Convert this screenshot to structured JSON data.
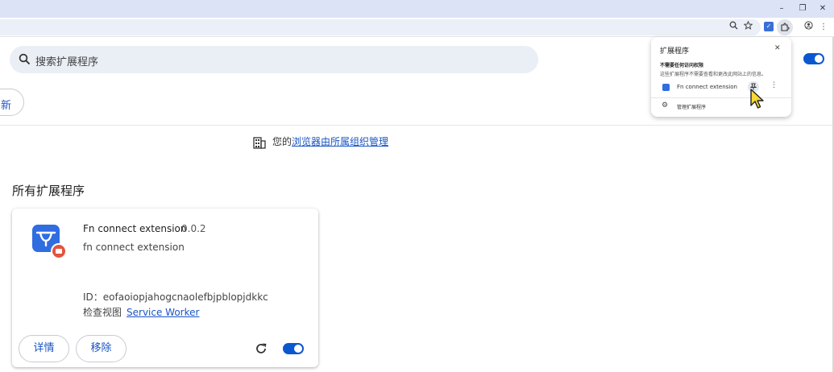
{
  "window": {
    "minimize_glyph": "–",
    "restore_glyph": "❐",
    "close_glyph": "✕"
  },
  "search": {
    "placeholder": "搜索扩展程序"
  },
  "header": {
    "update_label": "新",
    "developer_mode_on": true
  },
  "managed": {
    "prefix": "您的",
    "link": "浏览器由所属组织管理"
  },
  "section": {
    "title": "所有扩展程序"
  },
  "extension_card": {
    "name": "Fn connect extension",
    "version": "0.0.2",
    "description": "fn connect extension",
    "id_label": "ID：",
    "id": "eofaoiopjahogcnaolefbjpblopjdkkc",
    "views_label": "检查视图",
    "views_link": "Service Worker",
    "details_label": "详情",
    "remove_label": "移除",
    "enabled": true
  },
  "popup": {
    "title": "扩展程序",
    "close_glyph": "✕",
    "heading": "不需要任何访问权限",
    "subtext": "这些扩展程序不需要查看和更改此网站上的信息。",
    "items": [
      {
        "name": "Fn connect extension"
      }
    ],
    "more_glyph": "⋮",
    "manage_label": "管理扩展程序"
  },
  "colors": {
    "accent": "#0b57d0",
    "link": "#1a55c4",
    "titlebar": "#dce3f7",
    "search_bg": "#eaeef5",
    "extension_logo": "#2f6de1",
    "extension_badge": "#e5533d"
  },
  "icons": {
    "search": "search-icon",
    "building": "building-icon",
    "reload": "reload-icon",
    "puzzle": "puzzle-icon",
    "pin": "pin-icon",
    "gear": "gear-icon",
    "cursor": "pointer-cursor-icon"
  }
}
